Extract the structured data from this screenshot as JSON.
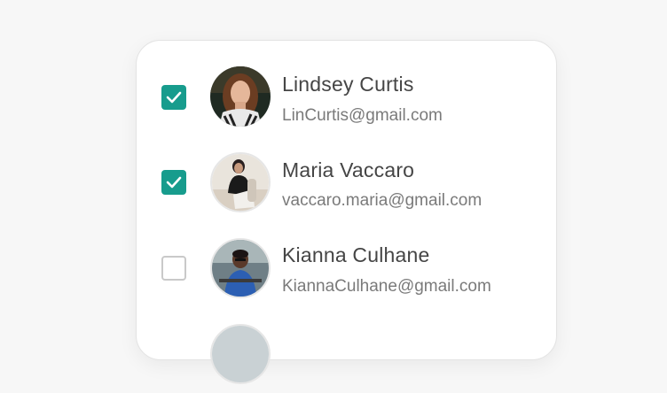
{
  "contacts": [
    {
      "name": "Lindsey Curtis",
      "email": "LinCurtis@gmail.com",
      "checked": true
    },
    {
      "name": "Maria Vaccaro",
      "email": "vaccaro.maria@gmail.com",
      "checked": true
    },
    {
      "name": "Kianna Culhane",
      "email": "KiannaCulhane@gmail.com",
      "checked": false
    },
    {
      "name": "",
      "email": "",
      "checked": false
    }
  ],
  "colors": {
    "accent": "#179c8d",
    "name_text": "#454545",
    "email_text": "#7a7a7a",
    "background": "#f7f7f7"
  },
  "icons": {
    "check": "check-icon"
  }
}
